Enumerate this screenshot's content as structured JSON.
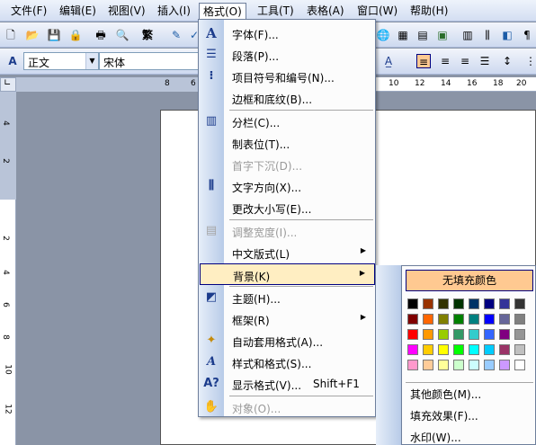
{
  "menubar": {
    "items": [
      "文件(F)",
      "编辑(E)",
      "视图(V)",
      "插入(I)",
      "格式(O)",
      "工具(T)",
      "表格(A)",
      "窗口(W)",
      "帮助(H)"
    ]
  },
  "toolbar": {
    "style_value": "正文",
    "font_value": "宋体"
  },
  "ruler": {
    "numbers": [
      "8",
      "6",
      "10",
      "12",
      "14",
      "16",
      "18",
      "20"
    ]
  },
  "vruler": {
    "numbers": [
      "4",
      "2",
      "2",
      "4",
      "6",
      "8",
      "10",
      "12"
    ]
  },
  "format_menu": {
    "items": [
      {
        "label": "字体(F)...",
        "icon": "font-icon",
        "disabled": false
      },
      {
        "label": "段落(P)...",
        "icon": "paragraph-icon",
        "disabled": false
      },
      {
        "label": "项目符号和编号(N)...",
        "icon": "bullets-icon",
        "disabled": false
      },
      {
        "label": "边框和底纹(B)...",
        "icon": "",
        "disabled": false
      },
      {
        "label": "分栏(C)...",
        "icon": "columns-icon",
        "disabled": false
      },
      {
        "label": "制表位(T)...",
        "icon": "",
        "disabled": false
      },
      {
        "label": "首字下沉(D)...",
        "icon": "",
        "disabled": true
      },
      {
        "label": "文字方向(X)...",
        "icon": "text-direction-icon",
        "disabled": false
      },
      {
        "label": "更改大小写(E)...",
        "icon": "",
        "disabled": false
      },
      {
        "label": "调整宽度(I)...",
        "icon": "fit-width-icon",
        "disabled": true
      },
      {
        "label": "中文版式(L)",
        "icon": "",
        "disabled": false,
        "submenu": true
      },
      {
        "label": "背景(K)",
        "icon": "",
        "disabled": false,
        "submenu": true
      },
      {
        "label": "主题(H)...",
        "icon": "theme-icon",
        "disabled": false
      },
      {
        "label": "框架(R)",
        "icon": "",
        "disabled": false,
        "submenu": true
      },
      {
        "label": "自动套用格式(A)...",
        "icon": "autoformat-icon",
        "disabled": false
      },
      {
        "label": "样式和格式(S)...",
        "icon": "styles-icon",
        "disabled": false
      },
      {
        "label": "显示格式(V)...",
        "icon": "reveal-format-icon",
        "disabled": false,
        "shortcut": "Shift+F1"
      },
      {
        "label": "对象(O)...",
        "icon": "object-icon",
        "disabled": true
      }
    ]
  },
  "background_menu": {
    "no_fill": "无填充颜色",
    "more_colors": "其他颜色(M)...",
    "fill_effects": "填充效果(F)...",
    "watermark": "水印(W)...",
    "swatch_colors": [
      [
        "#000000",
        "#993300",
        "#333300",
        "#003300",
        "#003366",
        "#000080",
        "#333399",
        "#333333"
      ],
      [
        "#800000",
        "#ff6600",
        "#808000",
        "#008000",
        "#008080",
        "#0000ff",
        "#666699",
        "#808080"
      ],
      [
        "#ff0000",
        "#ff9900",
        "#99cc00",
        "#339966",
        "#33cccc",
        "#3366ff",
        "#800080",
        "#969696"
      ],
      [
        "#ff00ff",
        "#ffcc00",
        "#ffff00",
        "#00ff00",
        "#00ffff",
        "#00ccff",
        "#993366",
        "#c0c0c0"
      ],
      [
        "#ff99cc",
        "#ffcc99",
        "#ffff99",
        "#ccffcc",
        "#ccffff",
        "#99ccff",
        "#cc99ff",
        "#ffffff"
      ]
    ]
  }
}
